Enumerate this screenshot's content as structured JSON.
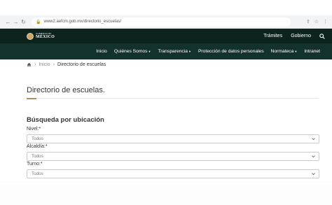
{
  "browser": {
    "url": "www2.aefcm.gob.mx/directorio_escuelas/"
  },
  "header": {
    "logo_small": "GOBIERNO DE",
    "logo_big": "MÉXICO",
    "links": [
      "Trámites",
      "Gobierno"
    ]
  },
  "nav": {
    "items": [
      "Inicio",
      "Quiénes Somos",
      "Transparencia",
      "Protección de datos personales",
      "Normateca",
      "Intranet"
    ],
    "dropdowns": [
      false,
      true,
      true,
      false,
      true,
      false
    ]
  },
  "breadcrumb": {
    "home": "Inicio",
    "current": "Directorio de escuelas"
  },
  "main": {
    "title": "Directorio de escuelas.",
    "section_title": "Búsqueda por ubicación",
    "fields": [
      {
        "label": "Nivel:*",
        "value": "Todos"
      },
      {
        "label": "Alcaldía:*",
        "value": "Todos"
      },
      {
        "label": "Turno:*",
        "value": "Todos"
      }
    ]
  },
  "colors": {
    "header_dark": "#0c231e",
    "nav_green": "#13322b",
    "accent_gold": "#b38e5d"
  }
}
